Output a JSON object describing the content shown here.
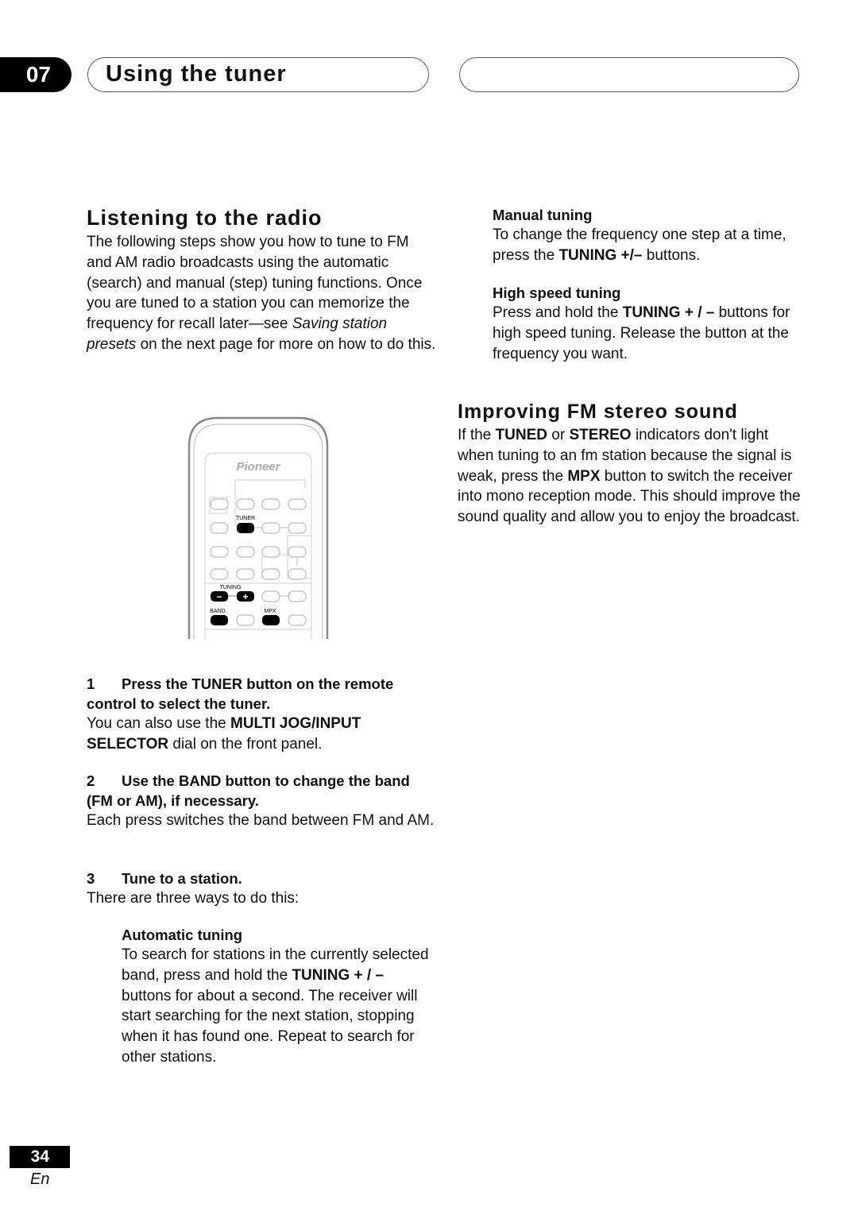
{
  "header": {
    "chapter_number": "07",
    "chapter_title": "Using the tuner"
  },
  "section_listening": {
    "heading": "Listening to the radio",
    "intro_part1": "The following steps show you how to tune to FM and AM radio broadcasts using the automatic (search) and manual (step) tuning functions. Once you are tuned to a station you can memorize the frequency for recall later—see ",
    "intro_link": "Saving station presets",
    "intro_part2": " on the next page for more on how to do this."
  },
  "remote": {
    "brand": "Pioneer",
    "labels": {
      "tuner": "TUNER",
      "tuning": "TUNING",
      "band": "BAND",
      "mpx": "MPX",
      "minus": "−",
      "plus": "+"
    }
  },
  "steps": [
    {
      "number": "1",
      "title": "Press the TUNER button on the remote control to select the tuner.",
      "body_pre": "You can also use the ",
      "body_bold": "MULTI JOG/INPUT SELECTOR",
      "body_post": " dial on the front panel."
    },
    {
      "number": "2",
      "title": "Use the BAND button to change the band (FM or AM), if necessary.",
      "body": "Each press switches the band between FM and AM."
    },
    {
      "number": "3",
      "title": "Tune to a station.",
      "body": "There are three ways to do this:"
    }
  ],
  "automatic_tuning": {
    "heading": "Automatic tuning",
    "pre": "To search for stations in the currently selected band, press and hold the ",
    "bold": "TUNING + / –",
    "post": " buttons for about a second. The receiver will start searching for the next station, stopping when it has found one. Repeat to search for other stations."
  },
  "manual_tuning": {
    "heading": "Manual tuning",
    "pre": "To change the frequency one step at a time, press the ",
    "bold": "TUNING +/–",
    "post": " buttons."
  },
  "high_speed_tuning": {
    "heading": "High speed tuning",
    "pre": "Press and hold the ",
    "bold": "TUNING + / –",
    "post": " buttons for high speed tuning. Release the button at the frequency you want."
  },
  "section_fm": {
    "heading": "Improving FM stereo sound",
    "t1": "If the ",
    "b1": "TUNED",
    "t2": " or ",
    "b2": "STEREO",
    "t3": " indicators don't light when tuning to an fm station because the signal is weak, press the ",
    "b3": "MPX",
    "t4": " button to switch the receiver into mono reception mode. This should improve the sound quality and allow you to enjoy the broadcast."
  },
  "footer": {
    "page_number": "34",
    "language": "En"
  }
}
